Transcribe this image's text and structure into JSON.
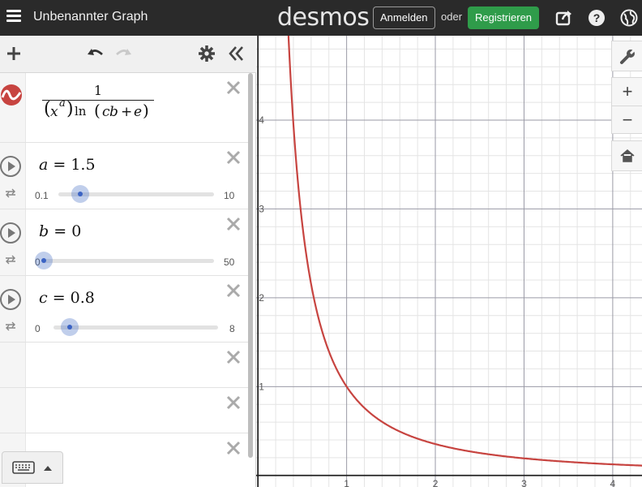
{
  "header": {
    "title": "Unbenannter Graph",
    "logo": "desmos",
    "login_label": "Anmelden",
    "or_label": "oder",
    "register_label": "Registrieren",
    "icons": [
      "menu-icon",
      "share-icon",
      "help-icon",
      "language-globe-icon"
    ]
  },
  "toolbar": {
    "icons": [
      "add-icon",
      "undo-icon",
      "redo-icon",
      "settings-gear-icon",
      "collapse-double-chevron-icon"
    ]
  },
  "expressions": [
    {
      "type": "function",
      "numerator": "1",
      "denominator_base": "x",
      "denominator_exp": "a",
      "denominator_fn": "ln",
      "denominator_arg_1": "c",
      "denominator_arg_2": "b",
      "denominator_op": "+",
      "denominator_arg_3": "e",
      "color": "#c74440"
    },
    {
      "type": "slider",
      "var": "a",
      "eq": "=",
      "value": "1.5",
      "min": "0.1",
      "max": "10",
      "fraction": 0.141
    },
    {
      "type": "slider",
      "var": "b",
      "eq": "=",
      "value": "0",
      "min": "0",
      "max": "50",
      "fraction": 0.0
    },
    {
      "type": "slider",
      "var": "c",
      "eq": "=",
      "value": "0.8",
      "min": "0",
      "max": "8",
      "fraction": 0.1
    }
  ],
  "graph": {
    "x_ticks": [
      "1",
      "2",
      "3",
      "4"
    ],
    "y_ticks": [
      "1",
      "2",
      "3",
      "4"
    ],
    "xlim": [
      -0.02,
      4.33
    ],
    "ylim": [
      -0.13,
      4.95
    ],
    "curve_color": "#c74440",
    "tools": [
      "wrench-icon",
      "zoom-in-icon",
      "zoom-out-icon",
      "home-icon"
    ],
    "zoom_in_label": "+",
    "zoom_out_label": "−"
  }
}
